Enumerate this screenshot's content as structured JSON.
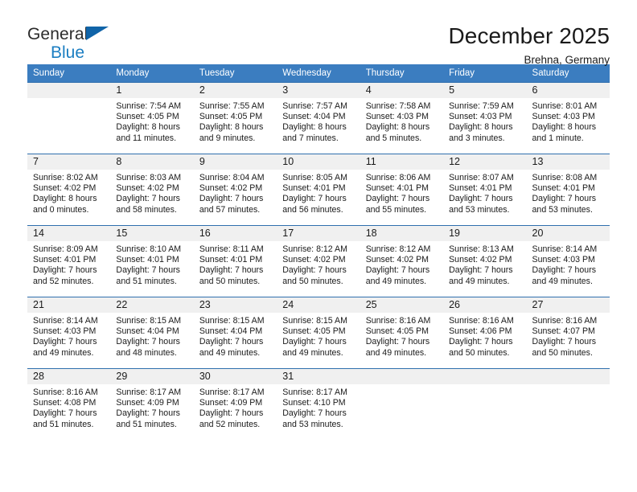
{
  "brand": {
    "name_top": "General",
    "name_bottom": "Blue",
    "triangle_color": "#1064a8",
    "blue_color": "#1b7ec2"
  },
  "header": {
    "title": "December 2025",
    "subtitle": "Brehna, Germany"
  },
  "colors": {
    "header_row_bg": "#3b7dc0",
    "day_strip_bg": "#f0f0f0",
    "row_divider": "#2f6fae"
  },
  "weekday_headers": [
    "Sunday",
    "Monday",
    "Tuesday",
    "Wednesday",
    "Thursday",
    "Friday",
    "Saturday"
  ],
  "weeks": [
    [
      {
        "day": "",
        "sunrise": "",
        "sunset": "",
        "daylight_line1": "",
        "daylight_line2": ""
      },
      {
        "day": "1",
        "sunrise": "Sunrise: 7:54 AM",
        "sunset": "Sunset: 4:05 PM",
        "daylight_line1": "Daylight: 8 hours",
        "daylight_line2": "and 11 minutes."
      },
      {
        "day": "2",
        "sunrise": "Sunrise: 7:55 AM",
        "sunset": "Sunset: 4:05 PM",
        "daylight_line1": "Daylight: 8 hours",
        "daylight_line2": "and 9 minutes."
      },
      {
        "day": "3",
        "sunrise": "Sunrise: 7:57 AM",
        "sunset": "Sunset: 4:04 PM",
        "daylight_line1": "Daylight: 8 hours",
        "daylight_line2": "and 7 minutes."
      },
      {
        "day": "4",
        "sunrise": "Sunrise: 7:58 AM",
        "sunset": "Sunset: 4:03 PM",
        "daylight_line1": "Daylight: 8 hours",
        "daylight_line2": "and 5 minutes."
      },
      {
        "day": "5",
        "sunrise": "Sunrise: 7:59 AM",
        "sunset": "Sunset: 4:03 PM",
        "daylight_line1": "Daylight: 8 hours",
        "daylight_line2": "and 3 minutes."
      },
      {
        "day": "6",
        "sunrise": "Sunrise: 8:01 AM",
        "sunset": "Sunset: 4:03 PM",
        "daylight_line1": "Daylight: 8 hours",
        "daylight_line2": "and 1 minute."
      }
    ],
    [
      {
        "day": "7",
        "sunrise": "Sunrise: 8:02 AM",
        "sunset": "Sunset: 4:02 PM",
        "daylight_line1": "Daylight: 8 hours",
        "daylight_line2": "and 0 minutes."
      },
      {
        "day": "8",
        "sunrise": "Sunrise: 8:03 AM",
        "sunset": "Sunset: 4:02 PM",
        "daylight_line1": "Daylight: 7 hours",
        "daylight_line2": "and 58 minutes."
      },
      {
        "day": "9",
        "sunrise": "Sunrise: 8:04 AM",
        "sunset": "Sunset: 4:02 PM",
        "daylight_line1": "Daylight: 7 hours",
        "daylight_line2": "and 57 minutes."
      },
      {
        "day": "10",
        "sunrise": "Sunrise: 8:05 AM",
        "sunset": "Sunset: 4:01 PM",
        "daylight_line1": "Daylight: 7 hours",
        "daylight_line2": "and 56 minutes."
      },
      {
        "day": "11",
        "sunrise": "Sunrise: 8:06 AM",
        "sunset": "Sunset: 4:01 PM",
        "daylight_line1": "Daylight: 7 hours",
        "daylight_line2": "and 55 minutes."
      },
      {
        "day": "12",
        "sunrise": "Sunrise: 8:07 AM",
        "sunset": "Sunset: 4:01 PM",
        "daylight_line1": "Daylight: 7 hours",
        "daylight_line2": "and 53 minutes."
      },
      {
        "day": "13",
        "sunrise": "Sunrise: 8:08 AM",
        "sunset": "Sunset: 4:01 PM",
        "daylight_line1": "Daylight: 7 hours",
        "daylight_line2": "and 53 minutes."
      }
    ],
    [
      {
        "day": "14",
        "sunrise": "Sunrise: 8:09 AM",
        "sunset": "Sunset: 4:01 PM",
        "daylight_line1": "Daylight: 7 hours",
        "daylight_line2": "and 52 minutes."
      },
      {
        "day": "15",
        "sunrise": "Sunrise: 8:10 AM",
        "sunset": "Sunset: 4:01 PM",
        "daylight_line1": "Daylight: 7 hours",
        "daylight_line2": "and 51 minutes."
      },
      {
        "day": "16",
        "sunrise": "Sunrise: 8:11 AM",
        "sunset": "Sunset: 4:01 PM",
        "daylight_line1": "Daylight: 7 hours",
        "daylight_line2": "and 50 minutes."
      },
      {
        "day": "17",
        "sunrise": "Sunrise: 8:12 AM",
        "sunset": "Sunset: 4:02 PM",
        "daylight_line1": "Daylight: 7 hours",
        "daylight_line2": "and 50 minutes."
      },
      {
        "day": "18",
        "sunrise": "Sunrise: 8:12 AM",
        "sunset": "Sunset: 4:02 PM",
        "daylight_line1": "Daylight: 7 hours",
        "daylight_line2": "and 49 minutes."
      },
      {
        "day": "19",
        "sunrise": "Sunrise: 8:13 AM",
        "sunset": "Sunset: 4:02 PM",
        "daylight_line1": "Daylight: 7 hours",
        "daylight_line2": "and 49 minutes."
      },
      {
        "day": "20",
        "sunrise": "Sunrise: 8:14 AM",
        "sunset": "Sunset: 4:03 PM",
        "daylight_line1": "Daylight: 7 hours",
        "daylight_line2": "and 49 minutes."
      }
    ],
    [
      {
        "day": "21",
        "sunrise": "Sunrise: 8:14 AM",
        "sunset": "Sunset: 4:03 PM",
        "daylight_line1": "Daylight: 7 hours",
        "daylight_line2": "and 49 minutes."
      },
      {
        "day": "22",
        "sunrise": "Sunrise: 8:15 AM",
        "sunset": "Sunset: 4:04 PM",
        "daylight_line1": "Daylight: 7 hours",
        "daylight_line2": "and 48 minutes."
      },
      {
        "day": "23",
        "sunrise": "Sunrise: 8:15 AM",
        "sunset": "Sunset: 4:04 PM",
        "daylight_line1": "Daylight: 7 hours",
        "daylight_line2": "and 49 minutes."
      },
      {
        "day": "24",
        "sunrise": "Sunrise: 8:15 AM",
        "sunset": "Sunset: 4:05 PM",
        "daylight_line1": "Daylight: 7 hours",
        "daylight_line2": "and 49 minutes."
      },
      {
        "day": "25",
        "sunrise": "Sunrise: 8:16 AM",
        "sunset": "Sunset: 4:05 PM",
        "daylight_line1": "Daylight: 7 hours",
        "daylight_line2": "and 49 minutes."
      },
      {
        "day": "26",
        "sunrise": "Sunrise: 8:16 AM",
        "sunset": "Sunset: 4:06 PM",
        "daylight_line1": "Daylight: 7 hours",
        "daylight_line2": "and 50 minutes."
      },
      {
        "day": "27",
        "sunrise": "Sunrise: 8:16 AM",
        "sunset": "Sunset: 4:07 PM",
        "daylight_line1": "Daylight: 7 hours",
        "daylight_line2": "and 50 minutes."
      }
    ],
    [
      {
        "day": "28",
        "sunrise": "Sunrise: 8:16 AM",
        "sunset": "Sunset: 4:08 PM",
        "daylight_line1": "Daylight: 7 hours",
        "daylight_line2": "and 51 minutes."
      },
      {
        "day": "29",
        "sunrise": "Sunrise: 8:17 AM",
        "sunset": "Sunset: 4:09 PM",
        "daylight_line1": "Daylight: 7 hours",
        "daylight_line2": "and 51 minutes."
      },
      {
        "day": "30",
        "sunrise": "Sunrise: 8:17 AM",
        "sunset": "Sunset: 4:09 PM",
        "daylight_line1": "Daylight: 7 hours",
        "daylight_line2": "and 52 minutes."
      },
      {
        "day": "31",
        "sunrise": "Sunrise: 8:17 AM",
        "sunset": "Sunset: 4:10 PM",
        "daylight_line1": "Daylight: 7 hours",
        "daylight_line2": "and 53 minutes."
      },
      {
        "day": "",
        "sunrise": "",
        "sunset": "",
        "daylight_line1": "",
        "daylight_line2": ""
      },
      {
        "day": "",
        "sunrise": "",
        "sunset": "",
        "daylight_line1": "",
        "daylight_line2": ""
      },
      {
        "day": "",
        "sunrise": "",
        "sunset": "",
        "daylight_line1": "",
        "daylight_line2": ""
      }
    ]
  ]
}
